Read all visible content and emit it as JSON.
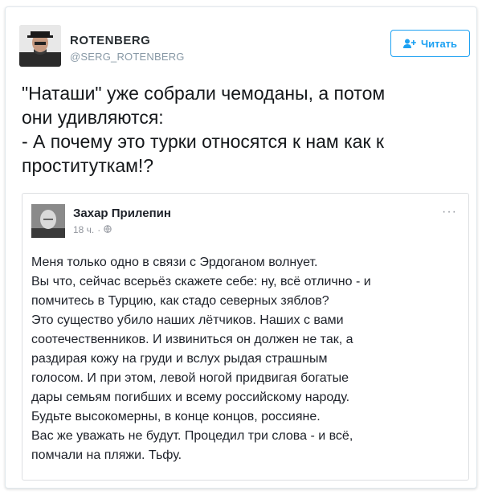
{
  "tweet": {
    "author_name": "ROTENBERG",
    "author_handle": "@SERG_ROTENBERG",
    "follow_label": "Читать",
    "text": "\"Наташи\" уже собрали чемоданы, а потом\nони удивляются:\n- А почему это турки относятся к нам как к\nпроституткам!?"
  },
  "quoted_post": {
    "author_name": "Захар Прилепин",
    "time": "18 ч.",
    "separator": "·",
    "privacy_icon": "globe-icon",
    "more_label": "···",
    "text": "Меня только одно в связи с Эрдоганом волнует.\nВы что, сейчас всерьёз скажете себе: ну, всё отлично - и\nпомчитесь в Турцию, как стадо северных зяблов?\nЭто существо убило наших лётчиков. Наших с вами\nсоотечественников. И извиниться он должен не так, а\nраздирая кожу на груди и вслух рыдая страшным\nголосом. И при этом, левой ногой придвигая богатые\nдары семьям погибших и всему российскому народу.\nБудьте высокомерны, в конце концов, россияне.\nВас же уважать не будут. Процедил три слова - и всё,\nпомчали на пляжи. Тьфу."
  },
  "colors": {
    "accent": "#1da1f2",
    "handle": "#8899a6",
    "text": "#14171a"
  }
}
